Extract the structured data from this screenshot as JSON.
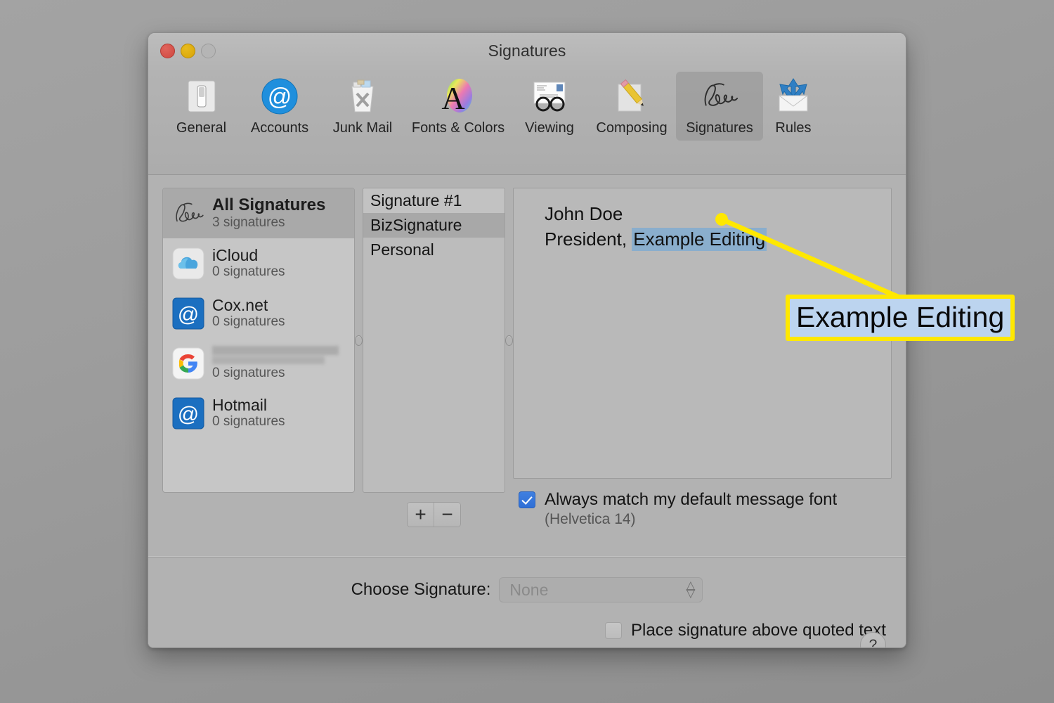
{
  "window": {
    "title": "Signatures",
    "traffic_lights": [
      "close-button",
      "minimize-button",
      "zoom-button"
    ]
  },
  "toolbar": {
    "items": [
      {
        "label": "General",
        "icon": "general-switch-icon",
        "selected": false
      },
      {
        "label": "Accounts",
        "icon": "at-sign-icon",
        "selected": false
      },
      {
        "label": "Junk Mail",
        "icon": "trash-can-icon",
        "selected": false
      },
      {
        "label": "Fonts & Colors",
        "icon": "letter-a-color-wheel-icon",
        "selected": false
      },
      {
        "label": "Viewing",
        "icon": "eyeglasses-mail-icon",
        "selected": false
      },
      {
        "label": "Composing",
        "icon": "pencil-paper-icon",
        "selected": false
      },
      {
        "label": "Signatures",
        "icon": "signature-scribble-icon",
        "selected": true
      },
      {
        "label": "Rules",
        "icon": "envelope-arrows-icon",
        "selected": false
      }
    ]
  },
  "accounts": {
    "items": [
      {
        "name": "All Signatures",
        "count": "3 signatures",
        "icon": "signature-scribble-icon",
        "selected": true,
        "redacted": false
      },
      {
        "name": "iCloud",
        "count": "0 signatures",
        "icon": "icloud-cloud-icon",
        "selected": false,
        "redacted": false
      },
      {
        "name": "Cox.net",
        "count": "0 signatures",
        "icon": "at-sign-icon",
        "selected": false,
        "redacted": false
      },
      {
        "name": "",
        "count": "0 signatures",
        "icon": "google-g-icon",
        "selected": false,
        "redacted": true
      },
      {
        "name": "Hotmail",
        "count": "0 signatures",
        "icon": "at-sign-icon",
        "selected": false,
        "redacted": false
      }
    ]
  },
  "signature_list": {
    "items": [
      {
        "label": "Signature #1",
        "selected": false
      },
      {
        "label": "BizSignature",
        "selected": true
      },
      {
        "label": "Personal",
        "selected": false
      }
    ],
    "add_label": "+",
    "remove_label": "−"
  },
  "editor": {
    "line1": "John Doe",
    "line2_prefix": "President, ",
    "line2_selected": "Example Editing"
  },
  "font_option": {
    "label": "Always match my default message font",
    "sublabel": "(Helvetica 14)",
    "checked": true
  },
  "footer": {
    "choose_signature_label": "Choose Signature:",
    "choose_signature_value": "None",
    "place_signature_label": "Place signature above quoted text",
    "place_signature_checked": false,
    "help_label": "?"
  },
  "annotation": {
    "callout_text": "Example Editing",
    "callout_border_color": "#ffe800",
    "callout_fill_color": "#bcd4ef",
    "leader_color": "#ffe800"
  },
  "colors": {
    "window_background": "#b2b2b2",
    "selection_blue": "#8aaecd",
    "checkbox_blue": "#3f7fe0",
    "desktop": "#9a9a9a"
  }
}
